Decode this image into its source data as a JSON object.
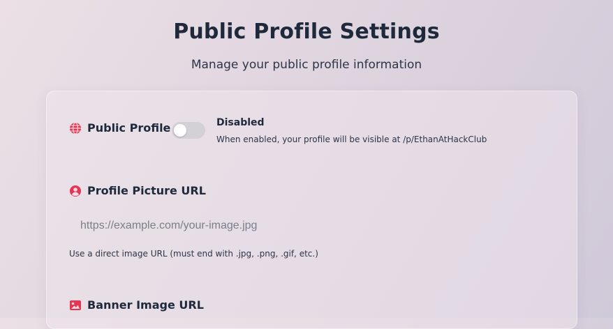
{
  "header": {
    "title": "Public Profile Settings",
    "subtitle": "Manage your public profile information"
  },
  "public_profile": {
    "label": "Public Profile",
    "icon": "globe-icon",
    "enabled": false,
    "status_text": "Disabled",
    "description": "When enabled, your profile will be visible at /p/EthanAtHackClub"
  },
  "profile_picture": {
    "label": "Profile Picture URL",
    "icon": "user-circle-icon",
    "value": "",
    "placeholder": "https://example.com/your-image.jpg",
    "help": "Use a direct image URL (must end with .jpg, .png, .gif, etc.)"
  },
  "banner_image": {
    "label": "Banner Image URL",
    "icon": "image-icon"
  },
  "colors": {
    "accent": "#e8344f",
    "toggle_off": "#d3d0d6",
    "text": "#1e293b"
  }
}
